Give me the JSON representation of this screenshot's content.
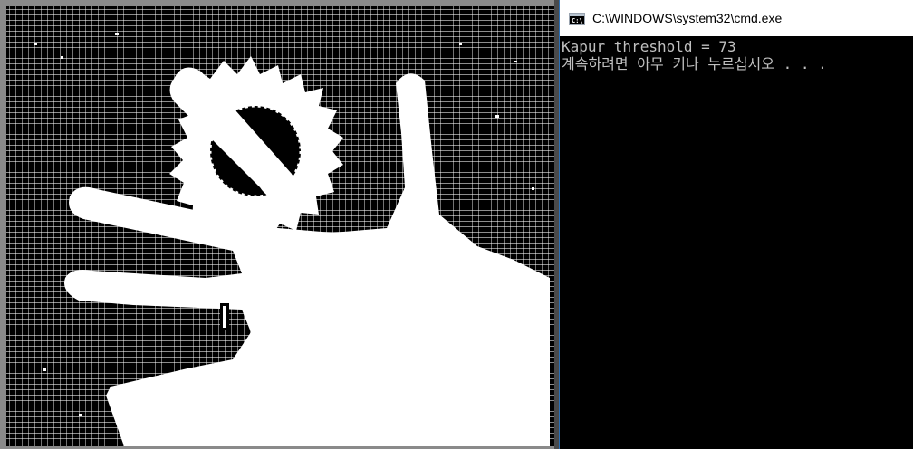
{
  "image_window": {
    "content": "binarized-hand-image"
  },
  "console": {
    "title": "C:\\WINDOWS\\system32\\cmd.exe",
    "icon": "cmd-icon",
    "lines": [
      "Kapur threshold = 73",
      "계속하려면 아무 키나 누르십시오 . . ."
    ]
  }
}
